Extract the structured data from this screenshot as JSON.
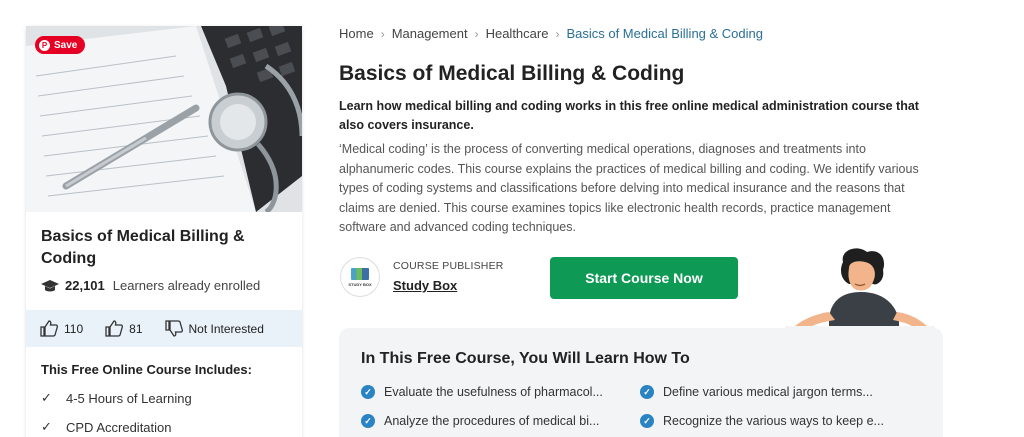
{
  "card": {
    "save_label": "Save",
    "title": "Basics of Medical Billing & Coding",
    "enrolled_count": "22,101",
    "enrolled_label": "Learners already enrolled",
    "likes": "110",
    "likes2": "81",
    "not_interested_label": "Not Interested",
    "includes_title": "This Free Online Course Includes:",
    "includes": [
      "4-5 Hours of Learning",
      "CPD Accreditation"
    ]
  },
  "breadcrumb": [
    "Home",
    "Management",
    "Healthcare",
    "Basics of Medical Billing & Coding"
  ],
  "course": {
    "title": "Basics of Medical Billing & Coding",
    "subtitle": "Learn how medical billing and coding works in this free online medical administration course that also covers insurance.",
    "description": "‘Medical coding’ is the process of converting medical operations, diagnoses and treatments into alphanumeric codes. This course explains the practices of medical billing and coding. We identify various types of coding systems and classifications before delving into medical insurance and the reasons that claims are denied. This course examines topics like electronic health records, practice management software and advanced coding techniques.",
    "publisher_label": "COURSE PUBLISHER",
    "publisher_name": "Study Box",
    "publisher_logo_text": "STUDY BOX",
    "start_label": "Start Course Now"
  },
  "learn": {
    "title": "In This Free Course, You Will Learn How To",
    "items": [
      "Evaluate the usefulness of pharmacol...",
      "Define various medical jargon terms...",
      "Analyze the procedures of medical bi...",
      "Recognize the various ways to keep e..."
    ]
  },
  "colors": {
    "accent_green": "#0e9a55",
    "link_blue": "#2a6f97",
    "pinterest_red": "#e60023",
    "check_blue": "#2a84c4"
  },
  "icons": [
    "pinterest-icon",
    "graduation-cap-icon",
    "thumbs-up-icon",
    "thumbs-down-icon",
    "checkmark-icon",
    "check-circle-icon",
    "chevron-right-icon"
  ]
}
